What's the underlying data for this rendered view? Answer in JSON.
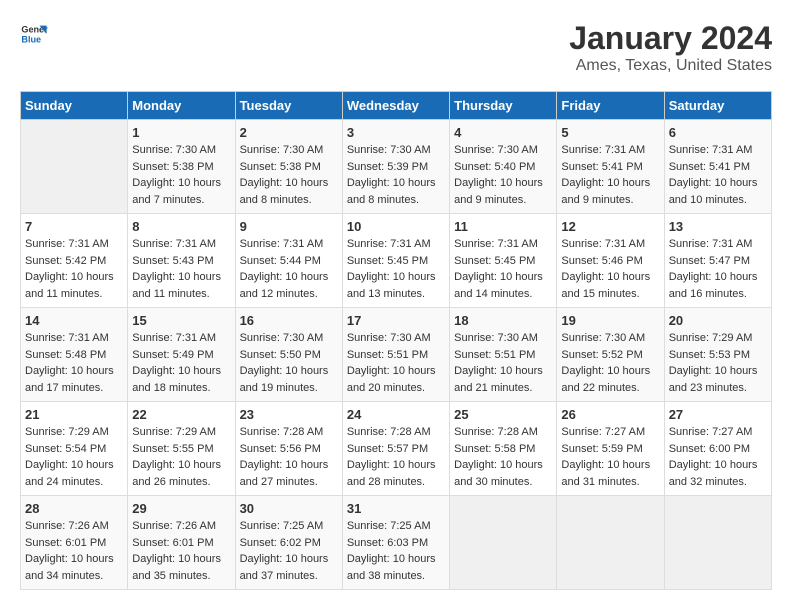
{
  "logo": {
    "text_general": "General",
    "text_blue": "Blue"
  },
  "title": "January 2024",
  "subtitle": "Ames, Texas, United States",
  "headers": [
    "Sunday",
    "Monday",
    "Tuesday",
    "Wednesday",
    "Thursday",
    "Friday",
    "Saturday"
  ],
  "weeks": [
    [
      {
        "num": "",
        "info": ""
      },
      {
        "num": "1",
        "info": "Sunrise: 7:30 AM\nSunset: 5:38 PM\nDaylight: 10 hours\nand 7 minutes."
      },
      {
        "num": "2",
        "info": "Sunrise: 7:30 AM\nSunset: 5:38 PM\nDaylight: 10 hours\nand 8 minutes."
      },
      {
        "num": "3",
        "info": "Sunrise: 7:30 AM\nSunset: 5:39 PM\nDaylight: 10 hours\nand 8 minutes."
      },
      {
        "num": "4",
        "info": "Sunrise: 7:30 AM\nSunset: 5:40 PM\nDaylight: 10 hours\nand 9 minutes."
      },
      {
        "num": "5",
        "info": "Sunrise: 7:31 AM\nSunset: 5:41 PM\nDaylight: 10 hours\nand 9 minutes."
      },
      {
        "num": "6",
        "info": "Sunrise: 7:31 AM\nSunset: 5:41 PM\nDaylight: 10 hours\nand 10 minutes."
      }
    ],
    [
      {
        "num": "7",
        "info": "Sunrise: 7:31 AM\nSunset: 5:42 PM\nDaylight: 10 hours\nand 11 minutes."
      },
      {
        "num": "8",
        "info": "Sunrise: 7:31 AM\nSunset: 5:43 PM\nDaylight: 10 hours\nand 11 minutes."
      },
      {
        "num": "9",
        "info": "Sunrise: 7:31 AM\nSunset: 5:44 PM\nDaylight: 10 hours\nand 12 minutes."
      },
      {
        "num": "10",
        "info": "Sunrise: 7:31 AM\nSunset: 5:45 PM\nDaylight: 10 hours\nand 13 minutes."
      },
      {
        "num": "11",
        "info": "Sunrise: 7:31 AM\nSunset: 5:45 PM\nDaylight: 10 hours\nand 14 minutes."
      },
      {
        "num": "12",
        "info": "Sunrise: 7:31 AM\nSunset: 5:46 PM\nDaylight: 10 hours\nand 15 minutes."
      },
      {
        "num": "13",
        "info": "Sunrise: 7:31 AM\nSunset: 5:47 PM\nDaylight: 10 hours\nand 16 minutes."
      }
    ],
    [
      {
        "num": "14",
        "info": "Sunrise: 7:31 AM\nSunset: 5:48 PM\nDaylight: 10 hours\nand 17 minutes."
      },
      {
        "num": "15",
        "info": "Sunrise: 7:31 AM\nSunset: 5:49 PM\nDaylight: 10 hours\nand 18 minutes."
      },
      {
        "num": "16",
        "info": "Sunrise: 7:30 AM\nSunset: 5:50 PM\nDaylight: 10 hours\nand 19 minutes."
      },
      {
        "num": "17",
        "info": "Sunrise: 7:30 AM\nSunset: 5:51 PM\nDaylight: 10 hours\nand 20 minutes."
      },
      {
        "num": "18",
        "info": "Sunrise: 7:30 AM\nSunset: 5:51 PM\nDaylight: 10 hours\nand 21 minutes."
      },
      {
        "num": "19",
        "info": "Sunrise: 7:30 AM\nSunset: 5:52 PM\nDaylight: 10 hours\nand 22 minutes."
      },
      {
        "num": "20",
        "info": "Sunrise: 7:29 AM\nSunset: 5:53 PM\nDaylight: 10 hours\nand 23 minutes."
      }
    ],
    [
      {
        "num": "21",
        "info": "Sunrise: 7:29 AM\nSunset: 5:54 PM\nDaylight: 10 hours\nand 24 minutes."
      },
      {
        "num": "22",
        "info": "Sunrise: 7:29 AM\nSunset: 5:55 PM\nDaylight: 10 hours\nand 26 minutes."
      },
      {
        "num": "23",
        "info": "Sunrise: 7:28 AM\nSunset: 5:56 PM\nDaylight: 10 hours\nand 27 minutes."
      },
      {
        "num": "24",
        "info": "Sunrise: 7:28 AM\nSunset: 5:57 PM\nDaylight: 10 hours\nand 28 minutes."
      },
      {
        "num": "25",
        "info": "Sunrise: 7:28 AM\nSunset: 5:58 PM\nDaylight: 10 hours\nand 30 minutes."
      },
      {
        "num": "26",
        "info": "Sunrise: 7:27 AM\nSunset: 5:59 PM\nDaylight: 10 hours\nand 31 minutes."
      },
      {
        "num": "27",
        "info": "Sunrise: 7:27 AM\nSunset: 6:00 PM\nDaylight: 10 hours\nand 32 minutes."
      }
    ],
    [
      {
        "num": "28",
        "info": "Sunrise: 7:26 AM\nSunset: 6:01 PM\nDaylight: 10 hours\nand 34 minutes."
      },
      {
        "num": "29",
        "info": "Sunrise: 7:26 AM\nSunset: 6:01 PM\nDaylight: 10 hours\nand 35 minutes."
      },
      {
        "num": "30",
        "info": "Sunrise: 7:25 AM\nSunset: 6:02 PM\nDaylight: 10 hours\nand 37 minutes."
      },
      {
        "num": "31",
        "info": "Sunrise: 7:25 AM\nSunset: 6:03 PM\nDaylight: 10 hours\nand 38 minutes."
      },
      {
        "num": "",
        "info": ""
      },
      {
        "num": "",
        "info": ""
      },
      {
        "num": "",
        "info": ""
      }
    ]
  ]
}
